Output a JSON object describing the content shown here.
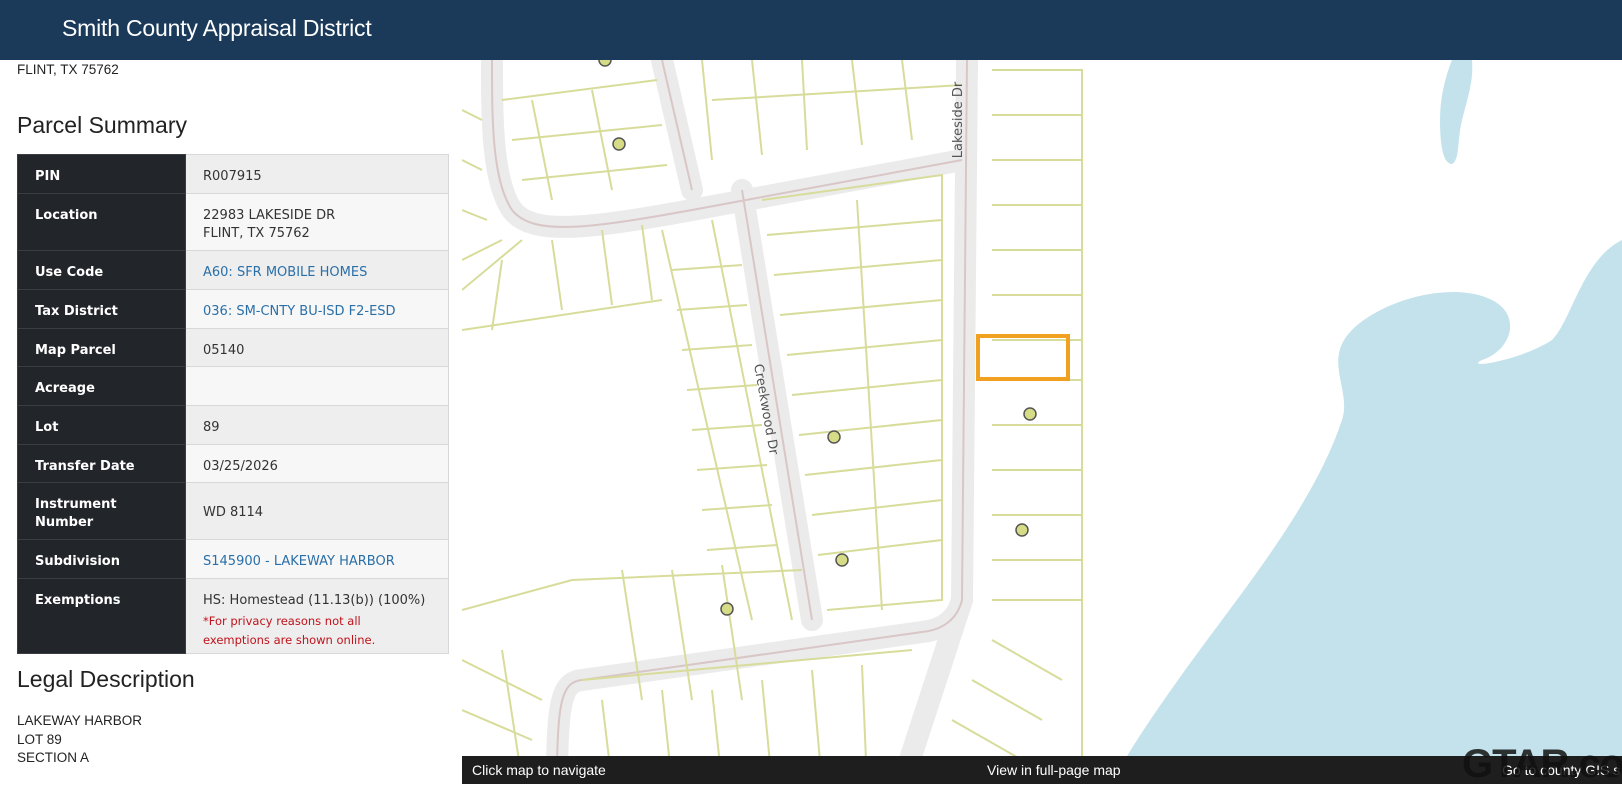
{
  "header": {
    "title": "Smith County Appraisal District"
  },
  "owner_address_tail": "FLINT, TX 75762",
  "parcel_summary": {
    "heading": "Parcel Summary",
    "rows": [
      {
        "label": "PIN",
        "value": "R007915"
      },
      {
        "label": "Location",
        "value": "22983 LAKESIDE DR",
        "value2": "FLINT, TX 75762"
      },
      {
        "label": "Use Code",
        "value": "A60: SFR MOBILE HOMES",
        "link": true
      },
      {
        "label": "Tax District",
        "value": "036: SM-CNTY BU-ISD F2-ESD",
        "link": true
      },
      {
        "label": "Map Parcel",
        "value": "05140"
      },
      {
        "label": "Acreage",
        "value": ""
      },
      {
        "label": "Lot",
        "value": "89"
      },
      {
        "label": "Transfer Date",
        "value": "03/25/2026"
      },
      {
        "label": "Instrument Number",
        "value": "WD 8114"
      },
      {
        "label": "Subdivision",
        "value": "S145900 - LAKEWAY HARBOR",
        "link": true
      },
      {
        "label": "Exemptions",
        "value": "HS: Homestead (11.13(b)) (100%)",
        "note": "*For privacy reasons not all exemptions are shown online."
      }
    ]
  },
  "legal_description": {
    "heading": "Legal Description",
    "lines": [
      "LAKEWAY HARBOR",
      "LOT 89",
      "SECTION A"
    ]
  },
  "map": {
    "street_labels": [
      "Lakeside Dr",
      "Creekwood Dr"
    ],
    "bar": {
      "left": "Click map to navigate",
      "center": "View in full-page map",
      "right": "Go to county GIS s"
    },
    "colors": {
      "water": "#c3e2ec",
      "parcel_line": "#d8dc9a",
      "road": "#ebebeb",
      "selected_parcel": "#f1a11f",
      "point": "#d6dc86"
    }
  },
  "watermark": "GTAR.com"
}
